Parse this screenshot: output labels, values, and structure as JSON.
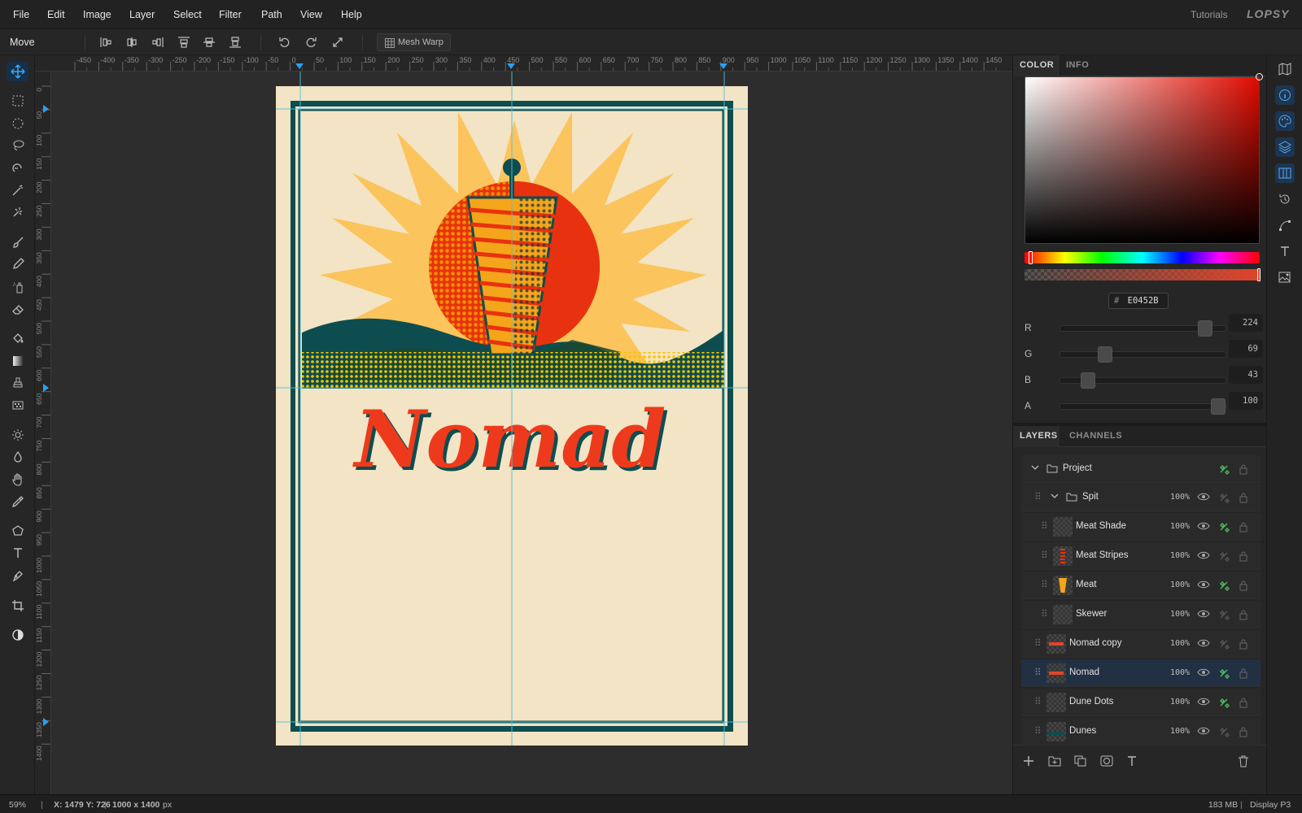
{
  "menubar": {
    "items": [
      "File",
      "Edit",
      "Image",
      "Layer",
      "Select",
      "Filter",
      "Path",
      "View",
      "Help"
    ],
    "tutorials": "Tutorials",
    "logo": "LOPSY"
  },
  "options": {
    "tool_name": "Move",
    "mesh_warp": "Mesh Warp"
  },
  "ruler": {
    "top_labels": [
      "-450",
      "-400",
      "-350",
      "-300",
      "-250",
      "-200",
      "-150",
      "-100",
      "-50",
      "0",
      "50",
      "100",
      "150",
      "200",
      "250",
      "300",
      "350",
      "400",
      "450",
      "500",
      "550",
      "600",
      "650",
      "700",
      "750",
      "800",
      "850",
      "900",
      "950",
      "1000",
      "1050",
      "1100",
      "1150",
      "1200",
      "1250",
      "1300",
      "1350",
      "1400",
      "1450"
    ],
    "left_labels": [
      "0",
      "50",
      "100",
      "150",
      "200",
      "250",
      "300",
      "350",
      "400",
      "450",
      "500",
      "550",
      "600",
      "650",
      "700",
      "750",
      "800",
      "850",
      "900",
      "950",
      "1000",
      "1050",
      "1100",
      "1150",
      "1200",
      "1250",
      "1300",
      "1350",
      "1400"
    ]
  },
  "poster": {
    "title": "Nomad"
  },
  "color_panel": {
    "tabs": [
      "COLOR",
      "INFO"
    ],
    "hex_prefix": "#",
    "hex": "E0452B",
    "channels": [
      {
        "label": "R",
        "value": "224",
        "fraction": 0.878
      },
      {
        "label": "G",
        "value": "69",
        "fraction": 0.27
      },
      {
        "label": "B",
        "value": "43",
        "fraction": 0.169
      },
      {
        "label": "A",
        "value": "100",
        "fraction": 1.0
      }
    ],
    "accent": "#E0452B"
  },
  "layers_panel": {
    "tabs": [
      "LAYERS",
      "CHANNELS"
    ],
    "layers": [
      {
        "name": "Project",
        "opacity": "",
        "type": "group-root",
        "visible": true,
        "linked": true
      },
      {
        "name": "Spit",
        "opacity": "100%",
        "type": "group",
        "visible": true,
        "linked": false
      },
      {
        "name": "Meat Shade",
        "opacity": "100%",
        "type": "child",
        "visible": true,
        "linked": true
      },
      {
        "name": "Meat Stripes",
        "opacity": "100%",
        "type": "child",
        "visible": true,
        "linked": false
      },
      {
        "name": "Meat",
        "opacity": "100%",
        "type": "child",
        "visible": true,
        "linked": true
      },
      {
        "name": "Skewer",
        "opacity": "100%",
        "type": "child",
        "visible": true,
        "linked": false
      },
      {
        "name": "Nomad copy",
        "opacity": "100%",
        "type": "layer",
        "visible": true,
        "linked": false
      },
      {
        "name": "Nomad",
        "opacity": "100%",
        "type": "layer",
        "visible": true,
        "linked": true,
        "selected": true
      },
      {
        "name": "Dune Dots",
        "opacity": "100%",
        "type": "layer",
        "visible": true,
        "linked": true
      },
      {
        "name": "Dunes",
        "opacity": "100%",
        "type": "layer",
        "visible": true,
        "linked": false
      }
    ]
  },
  "status": {
    "zoom": "59%",
    "coords": "X: 1479 Y: 726",
    "doc_size": "1000 x 1400",
    "doc_unit": "px",
    "memory": "183 MB",
    "display": "Display P3"
  }
}
